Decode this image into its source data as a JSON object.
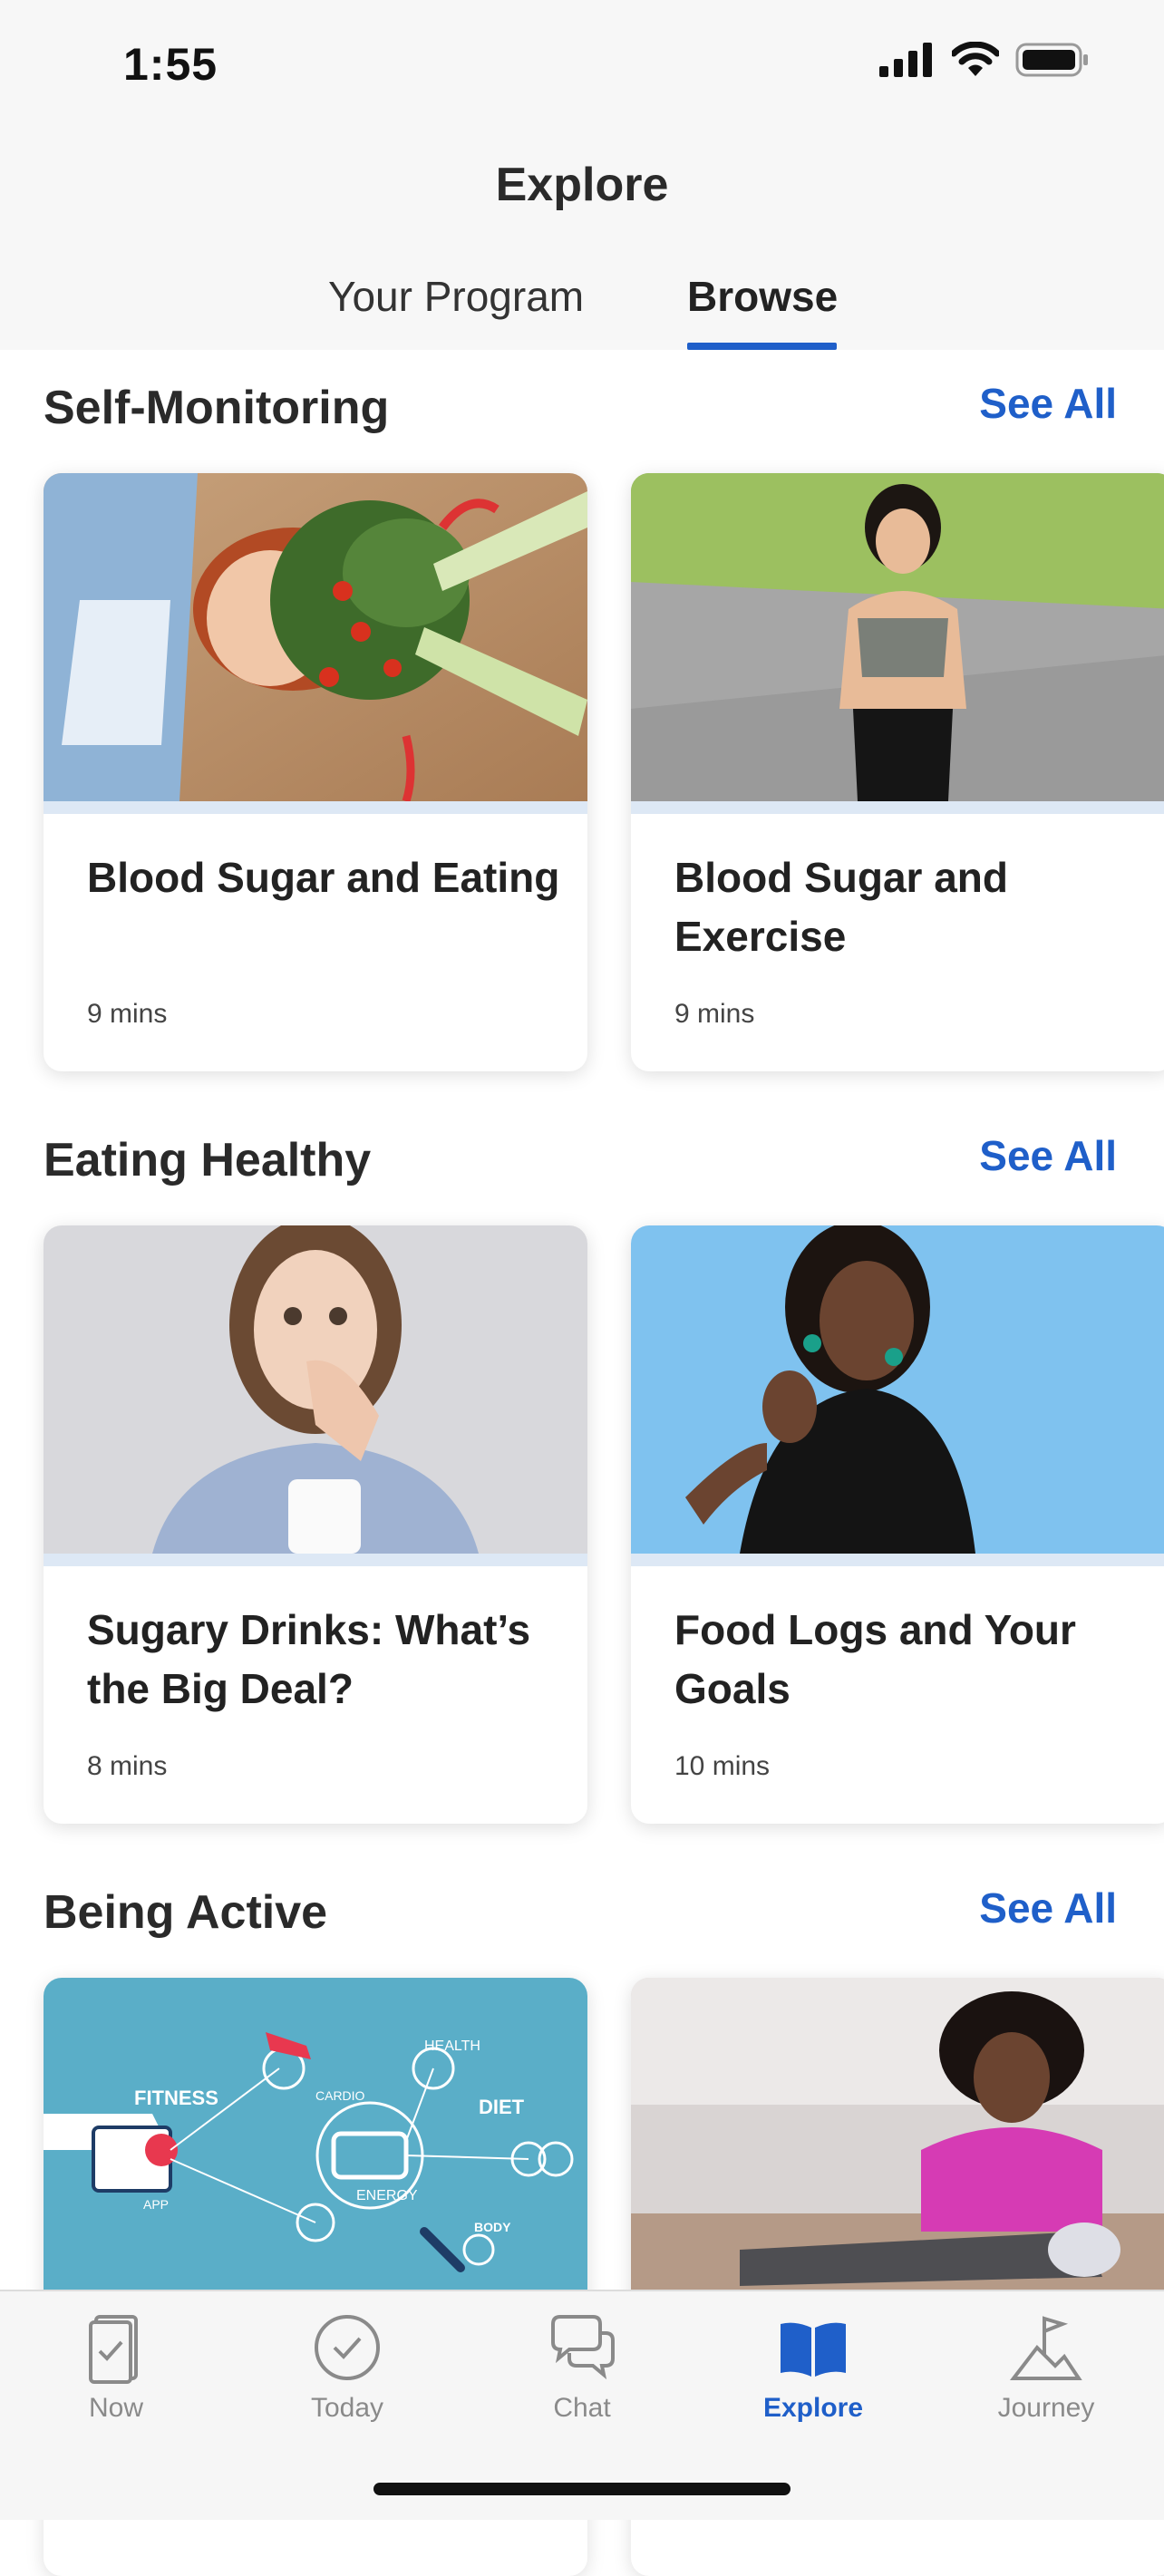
{
  "status_bar": {
    "time": "1:55"
  },
  "header": {
    "title": "Explore"
  },
  "tabs": [
    {
      "label": "Your Program",
      "active": false
    },
    {
      "label": "Browse",
      "active": true
    }
  ],
  "sections": [
    {
      "title": "Self-Monitoring",
      "see_all": "See All",
      "cards": [
        {
          "title": "Blood Sugar and Eating",
          "duration": "9 mins",
          "image": "woman-with-vegetables-photo"
        },
        {
          "title": "Blood Sugar and Exercise",
          "duration": "9 mins",
          "image": "woman-jogging-photo"
        }
      ]
    },
    {
      "title": "Eating Healthy",
      "see_all": "See All",
      "cards": [
        {
          "title": "Sugary Drinks: What’s the Big Deal?",
          "duration": "8 mins",
          "image": "surprised-woman-with-mug-photo"
        },
        {
          "title": "Food Logs and Your Goals",
          "duration": "10 mins",
          "image": "woman-thumbs-up-photo"
        }
      ]
    },
    {
      "title": "Being Active",
      "see_all": "See All",
      "cards": [
        {
          "image": "fitness-infographic",
          "labels": [
            "FITNESS",
            "HEALTH",
            "DIET",
            "CARDIO",
            "ENERGY",
            "APP",
            "BODY"
          ]
        },
        {
          "image": "woman-stretching-photo"
        }
      ]
    }
  ],
  "tab_bar": [
    {
      "label": "Now",
      "icon": "checklist-icon",
      "active": false
    },
    {
      "label": "Today",
      "icon": "check-circle-icon",
      "active": false
    },
    {
      "label": "Chat",
      "icon": "chat-bubbles-icon",
      "active": false
    },
    {
      "label": "Explore",
      "icon": "open-book-icon",
      "active": true
    },
    {
      "label": "Journey",
      "icon": "flag-mountain-icon",
      "active": false
    }
  ],
  "colors": {
    "accent": "#1f5fc9",
    "inactive": "#8a8a8a"
  }
}
